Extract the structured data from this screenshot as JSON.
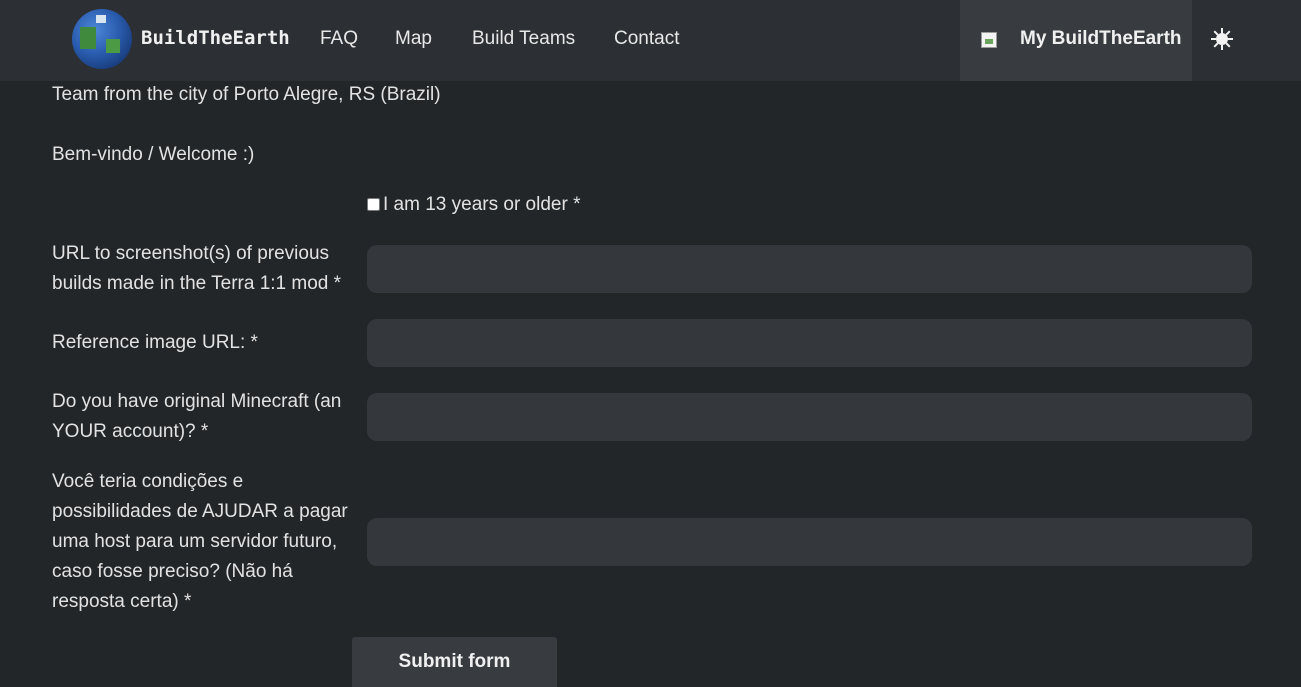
{
  "navbar": {
    "brand": "BuildTheEarth",
    "links": [
      "FAQ",
      "Map",
      "Build Teams",
      "Contact"
    ],
    "account_label": "My BuildTheEarth",
    "theme_icon": "sun-icon"
  },
  "description": {
    "line1": "Team from the city of Porto Alegre, RS (Brazil)",
    "line2": "Bem-vindo / Welcome :)"
  },
  "form": {
    "age_checkbox_label": "I am 13 years or older *",
    "fields": [
      {
        "label": "URL to screenshot(s) of previous builds made in the Terra 1:1 mod *",
        "value": ""
      },
      {
        "label": "Reference image URL: *",
        "value": ""
      },
      {
        "label": "Do you have original Minecraft (an YOUR account)? *",
        "value": ""
      },
      {
        "label": "Você teria condições e possibilidades de AJUDAR a pagar uma host para um servidor futuro, caso fosse preciso? (Não há resposta certa) *",
        "value": ""
      }
    ],
    "submit_label": "Submit form"
  },
  "colors": {
    "background": "#232629",
    "navbar": "#2c2f33",
    "input": "#34373c",
    "button": "#383b40"
  }
}
